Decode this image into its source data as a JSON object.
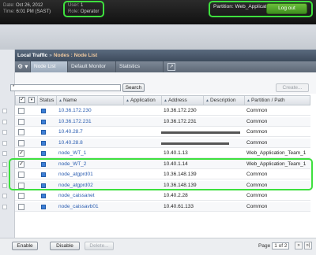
{
  "header": {
    "date_label": "Date:",
    "date_value": "Oct 26, 2012",
    "time_label": "Time:",
    "time_value": "6:01 PM (SAST)",
    "user_label": "User:",
    "user_value": "1",
    "role_label": "Role:",
    "role_value": "Operator",
    "partition_text": "Partition: Web_Application_Team_1",
    "logout_label": "Log out"
  },
  "breadcrumb": {
    "root": "Local Traffic",
    "sep": "»",
    "current": "Nodes : Node List"
  },
  "tabs": [
    {
      "label": "Node List",
      "active": true
    },
    {
      "label": "Default Monitor",
      "active": false
    },
    {
      "label": "Statistics",
      "active": false
    }
  ],
  "search": {
    "value": "*",
    "button_label": "Search",
    "create_label": "Create..."
  },
  "table": {
    "columns": [
      "Status",
      "Name",
      "Application",
      "Address",
      "Description",
      "Partition / Path"
    ],
    "rows": [
      {
        "name": "10.36.172.230",
        "address": "10.36.172.230",
        "partition": "Common",
        "checked": false
      },
      {
        "name": "10.36.172.231",
        "address": "10.36.172.231",
        "partition": "Common",
        "checked": false
      },
      {
        "name": "10.40.28.7",
        "address": "",
        "partition": "Common",
        "checked": false
      },
      {
        "name": "10.40.28.8",
        "address": "",
        "partition": "Common",
        "checked": false
      },
      {
        "name": "node_WT_1",
        "address": "10.40.1.13",
        "partition": "Web_Application_Team_1",
        "checked": true
      },
      {
        "name": "node_WT_2",
        "address": "10.40.1.14",
        "partition": "Web_Application_Team_1",
        "checked": true
      },
      {
        "name": "node_atgprd01",
        "address": "10.36.148.139",
        "partition": "Common",
        "checked": false
      },
      {
        "name": "node_atgprd02",
        "address": "10.36.148.139",
        "partition": "Common",
        "checked": false
      },
      {
        "name": "node_caissanet",
        "address": "10.40.2.28",
        "partition": "Common",
        "checked": false
      },
      {
        "name": "node_caissavb01",
        "address": "10.40.61.133",
        "partition": "Common",
        "checked": false
      }
    ]
  },
  "footer": {
    "enable_label": "Enable",
    "disable_label": "Disable",
    "delete_label": "Delete...",
    "page_label": "Page",
    "page_value": "1 of 2",
    "next_arrow": "»",
    "last_arrow": "»|"
  },
  "colors": {
    "highlight": "#3ee03e",
    "link": "#2a5db0",
    "status_blue": "#3d7fd6"
  }
}
